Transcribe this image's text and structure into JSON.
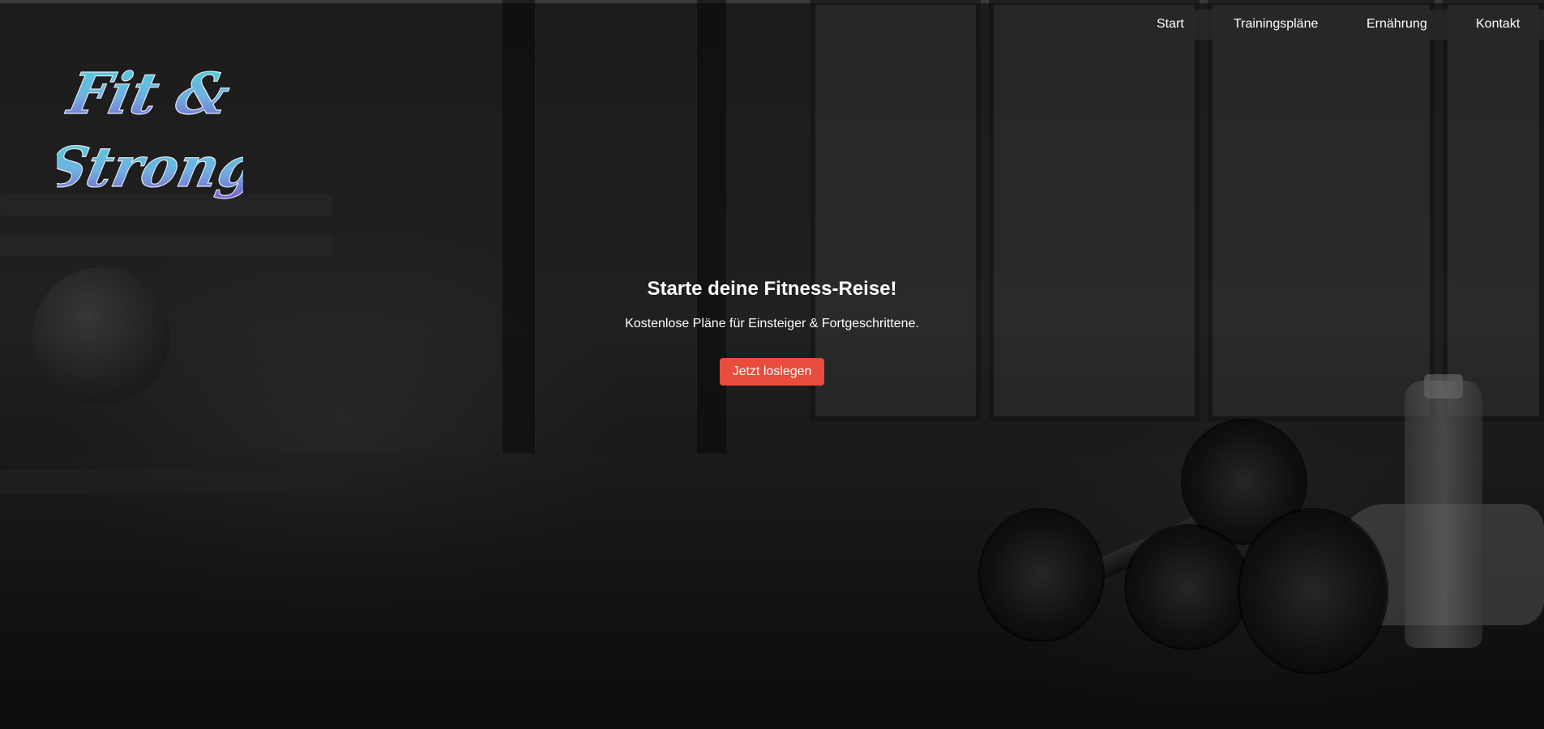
{
  "brand": {
    "logo_text": "Fit & Strong",
    "logo_gradient_top": "#4fd3d6",
    "logo_gradient_bottom": "#7a5bd1"
  },
  "nav": {
    "items": [
      {
        "label": "Start"
      },
      {
        "label": "Trainingspläne"
      },
      {
        "label": "Ernährung"
      },
      {
        "label": "Kontakt"
      }
    ]
  },
  "hero": {
    "title": "Starte deine Fitness-Reise!",
    "subtitle": "Kostenlose Pläne für Einsteiger & Fortgeschrittene.",
    "cta_label": "Jetzt loslegen"
  },
  "colors": {
    "accent": "#e74c3c",
    "nav_background": "#282828",
    "text": "#ffffff"
  }
}
